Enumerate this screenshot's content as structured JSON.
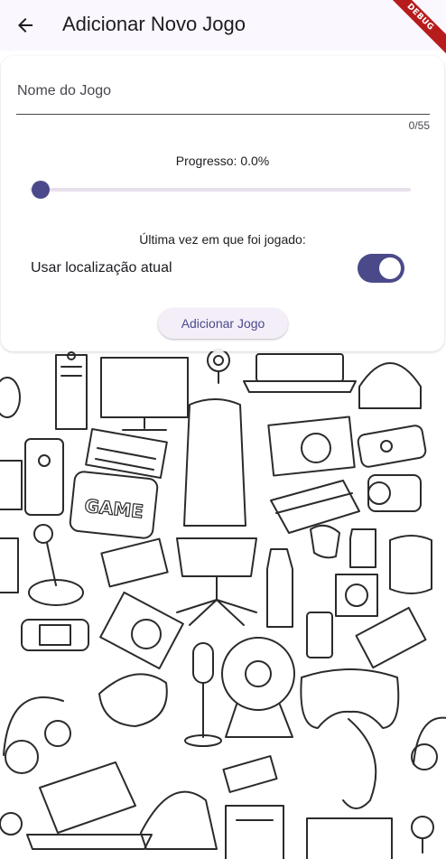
{
  "appbar": {
    "title": "Adicionar Novo Jogo",
    "back_icon": "arrow-back-icon",
    "debug_banner": "DEBUG"
  },
  "form": {
    "name_field": {
      "placeholder": "Nome do Jogo",
      "value": "",
      "counter": "0/55"
    },
    "progress": {
      "label": "Progresso: 0.0%",
      "value": 0.0
    },
    "last_played_label": "Última vez em que foi jogado:",
    "use_location": {
      "label": "Usar localização atual",
      "enabled": true
    },
    "submit_label": "Adicionar Jogo"
  },
  "colors": {
    "primary": "#4a4a8a",
    "appbar_bg": "#fbf7ff",
    "card_bg": "#ffffff",
    "track": "#e7e0ec",
    "button_bg": "#f3eef8",
    "debug": "#b71c1c"
  },
  "background": {
    "pattern_icons": [
      "game-icon",
      "controller-icon",
      "monitor-icon",
      "keyboard-icon",
      "gaming-chair-icon",
      "headphones-icon",
      "laptop-icon",
      "joystick-icon",
      "microphone-icon",
      "steering-wheel-icon",
      "mouse-icon",
      "pc-tower-icon",
      "console-icon",
      "energy-drink-icon",
      "micro-sd-icon",
      "webcam-icon",
      "vr-headset-icon",
      "handheld-console-icon",
      "speaker-icon"
    ]
  }
}
